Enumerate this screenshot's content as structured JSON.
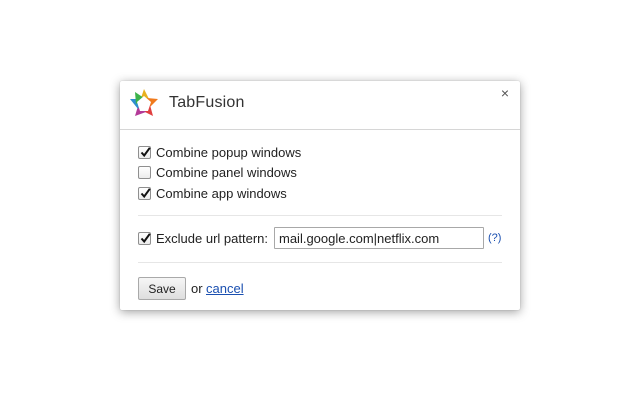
{
  "dialog": {
    "title": "TabFusion",
    "close_glyph": "×",
    "logo_icon": "tabfusion-star-logo"
  },
  "options": [
    {
      "label": "Combine popup windows",
      "checked": true
    },
    {
      "label": "Combine panel windows",
      "checked": false
    },
    {
      "label": "Combine app windows",
      "checked": true
    }
  ],
  "exclude": {
    "label": "Exclude url pattern:",
    "checked": true,
    "value": "mail.google.com|netflix.com",
    "help_label": "(?)"
  },
  "actions": {
    "save_label": "Save",
    "or_text": "or",
    "cancel_label": "cancel"
  },
  "colors": {
    "link": "#1a4fb0",
    "logo_petals": [
      "#e8b01e",
      "#f07a1d",
      "#e03f3f",
      "#b33a98",
      "#2e8fd0",
      "#3db34b"
    ]
  }
}
